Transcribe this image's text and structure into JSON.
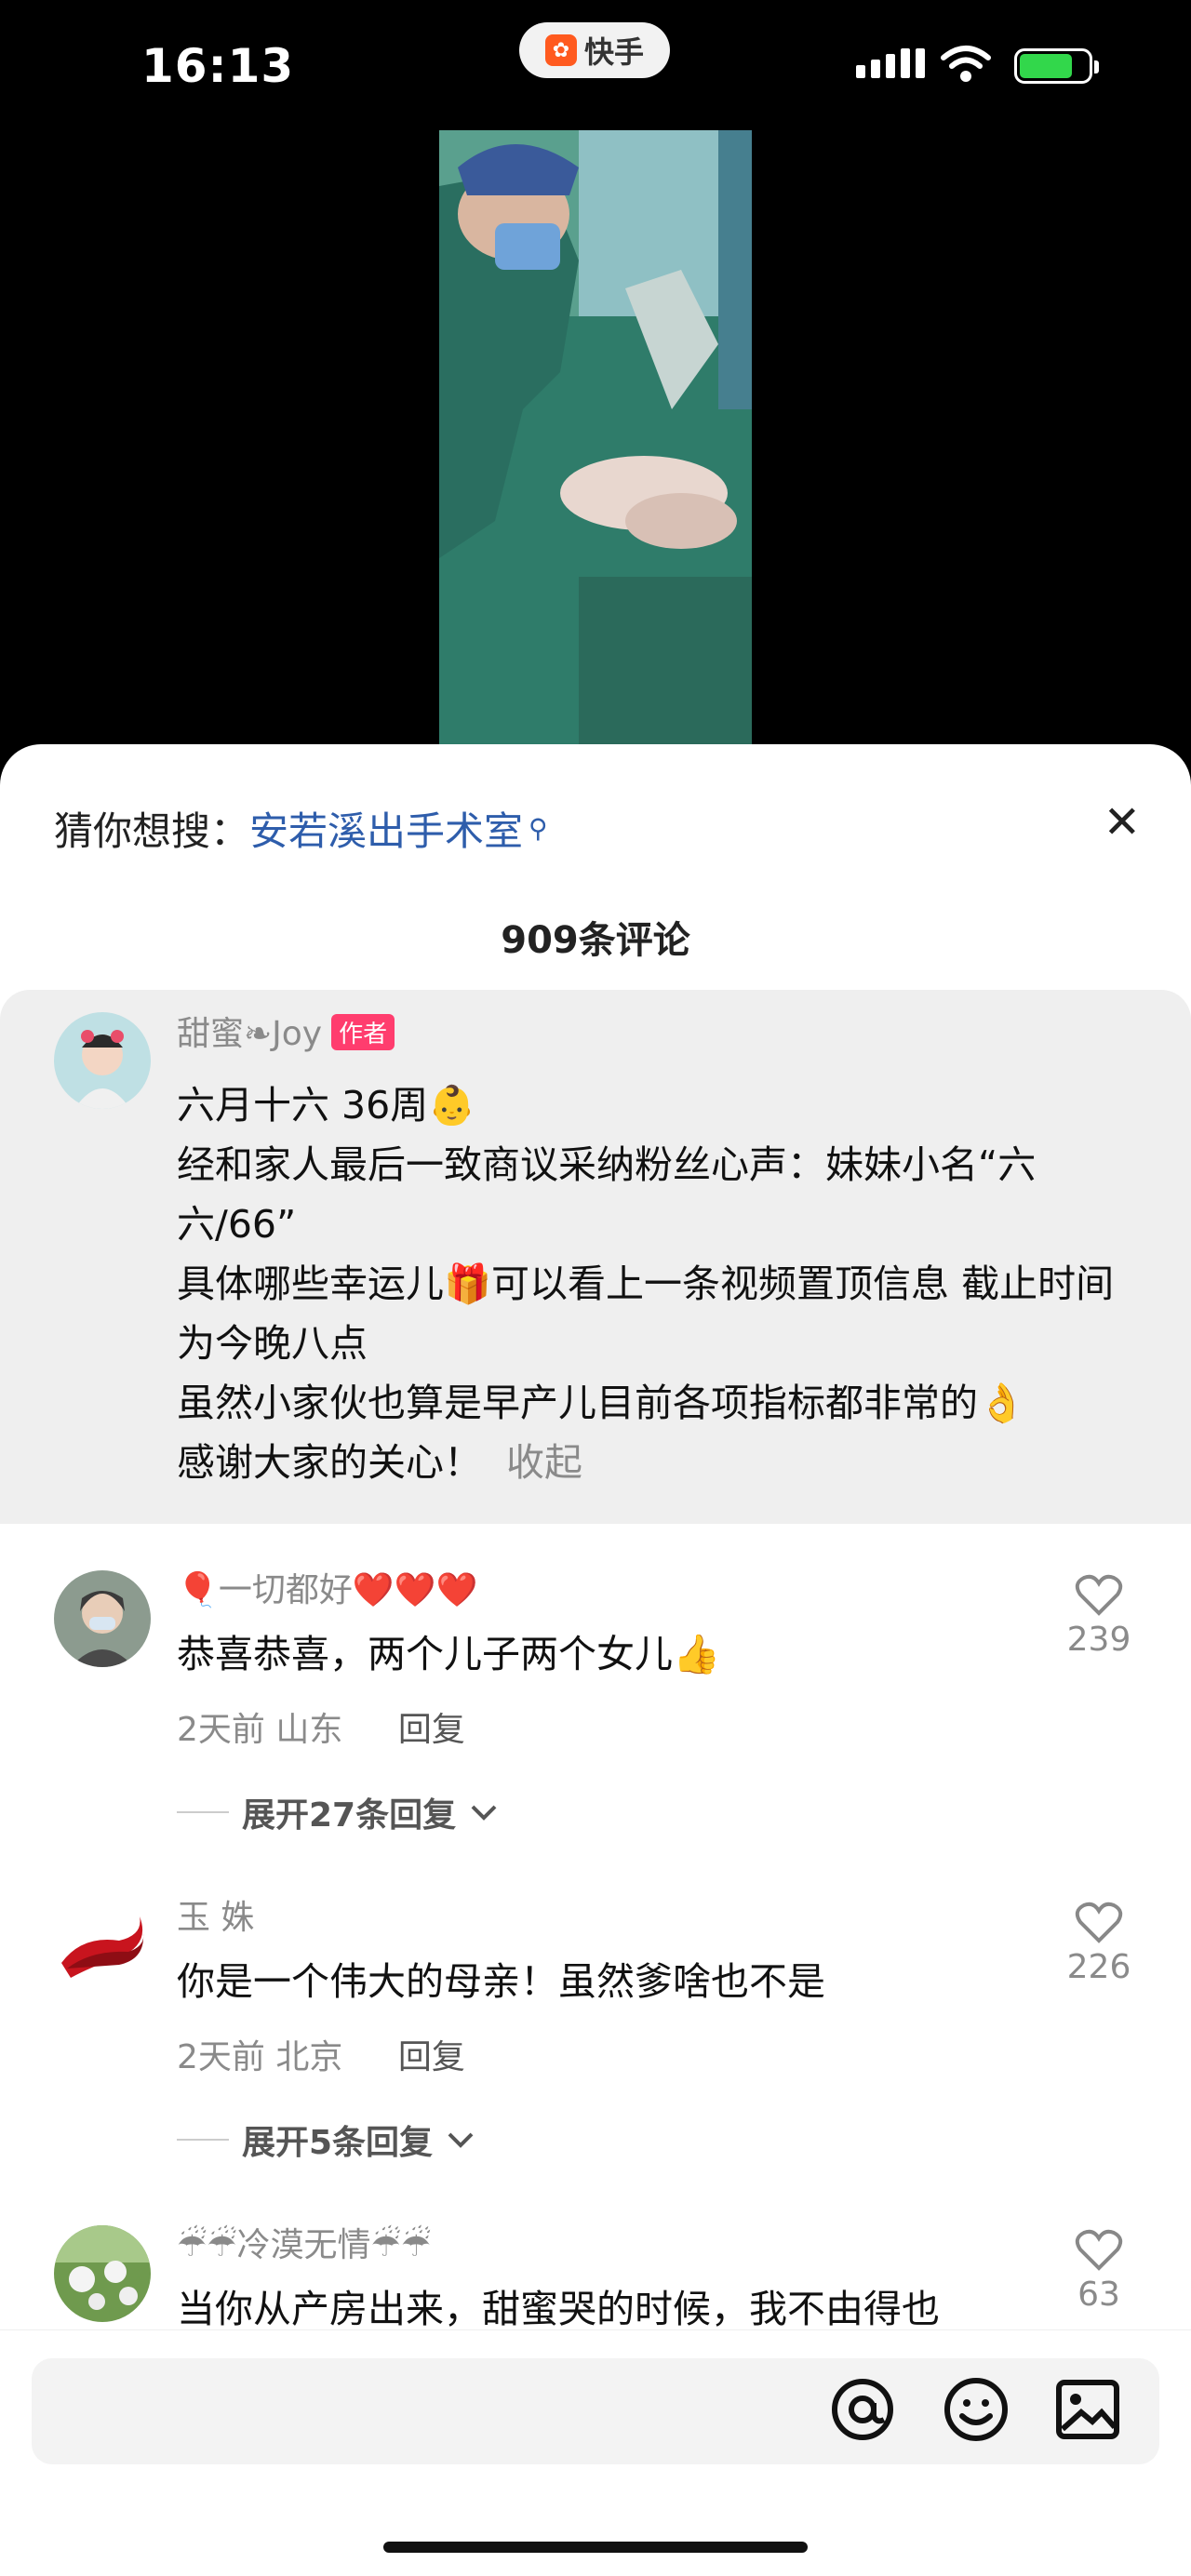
{
  "status_bar": {
    "time": "16:13",
    "app_badge": "快手"
  },
  "search_hint": {
    "prefix": "猜你想搜：",
    "query": "安若溪出手术室"
  },
  "comment_count": "909条评论",
  "pinned": {
    "username": "甜蜜❧Joy",
    "badge": "作者",
    "lines": [
      "六月十六 36周👶",
      "经和家人最后一致商议采纳粉丝心声：妹妹小名“六六/66”",
      "具体哪些幸运儿🎁可以看上一条视频置顶信息 截止时间为今晚八点",
      "虽然小家伙也算是早产儿目前各项指标都非常的👌",
      "感谢大家的关心！"
    ],
    "fold": "收起"
  },
  "comments": [
    {
      "username": "🎈一切都好❤️❤️❤️",
      "text": "恭喜恭喜，两个儿子两个女儿👍",
      "time": "2天前",
      "location": "山东",
      "reply": "回复",
      "likes": "239",
      "expand": "展开27条回复"
    },
    {
      "username": "玉 姝",
      "text": "你是一个伟大的母亲！虽然爹啥也不是",
      "time": "2天前",
      "location": "北京",
      "reply": "回复",
      "likes": "226",
      "expand": "展开5条回复"
    },
    {
      "username": "☔☔冷漠无情☔☔",
      "text": "当你从产房出来，甜蜜哭的时候，我不由得也",
      "likes": "63"
    }
  ],
  "icons": {
    "at": "at-icon",
    "emoji": "emoji-icon",
    "image": "image-icon",
    "close": "close-icon",
    "like": "heart-icon"
  },
  "colors": {
    "link": "#2e5dab",
    "author_badge": "#ff3d6e",
    "app_logo": "#ff5a1f"
  }
}
